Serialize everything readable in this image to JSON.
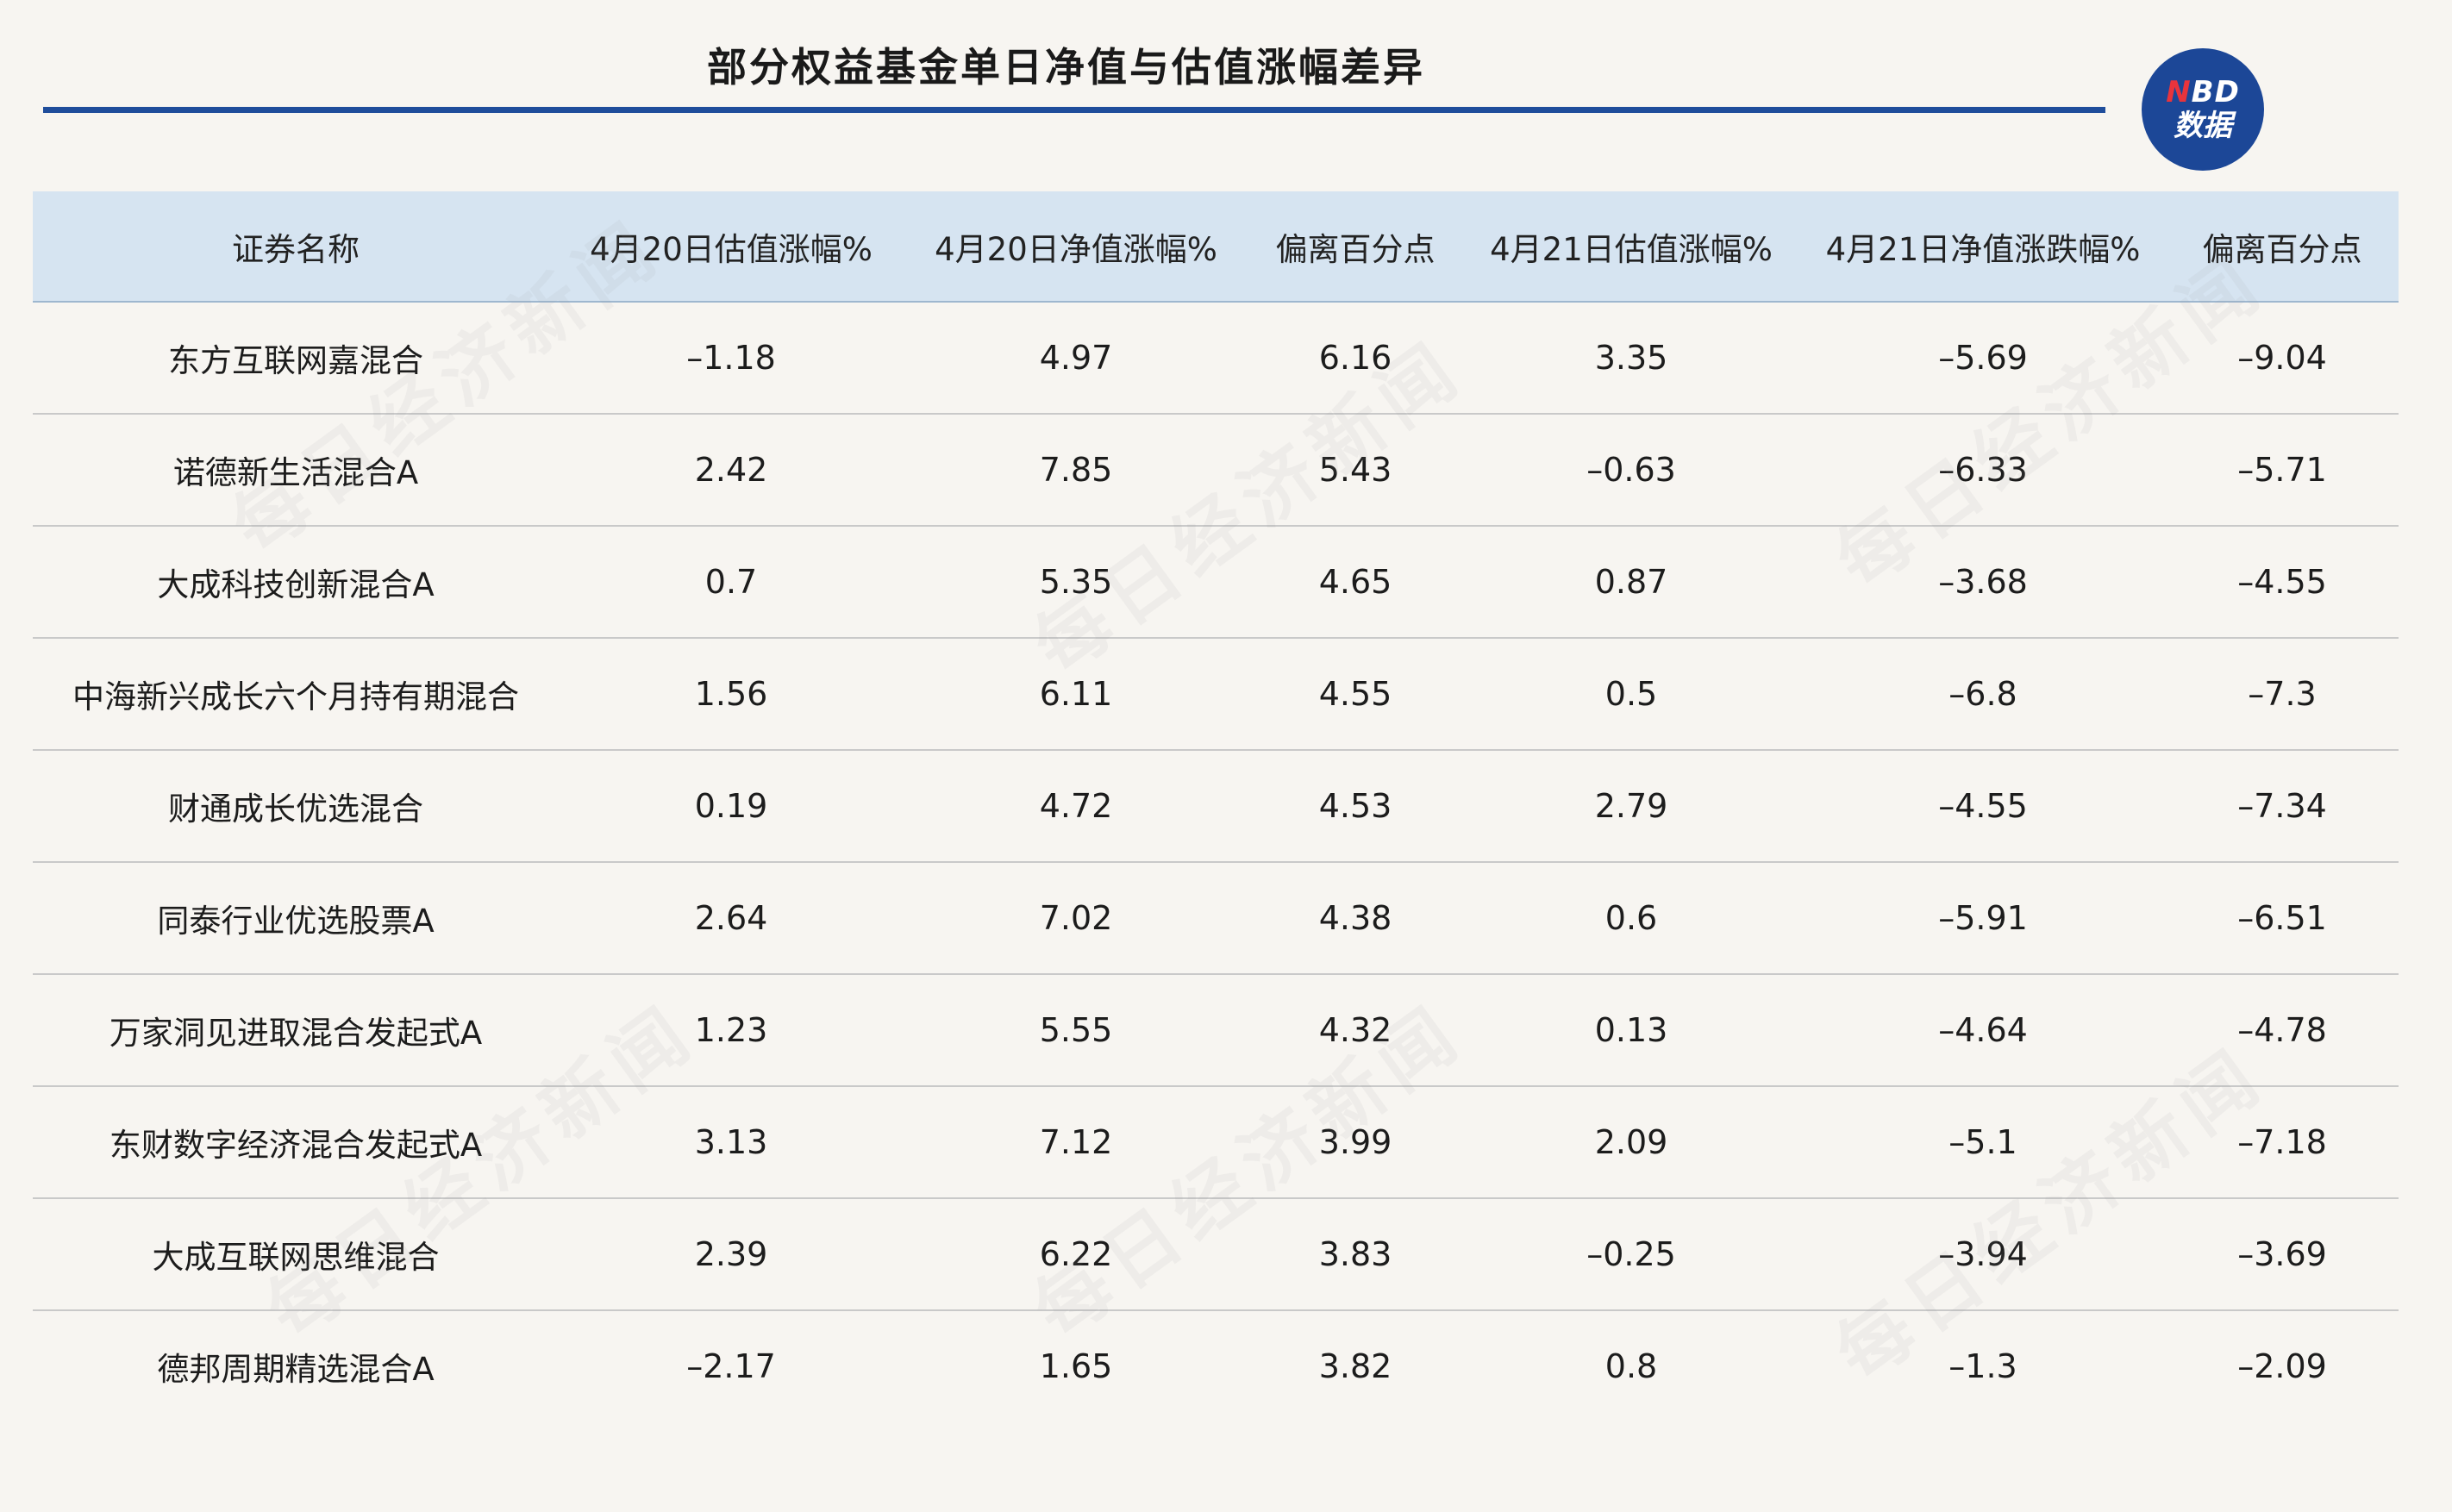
{
  "title": "部分权益基金单日净值与估值涨幅差异",
  "logo": {
    "line1_n": "N",
    "line1_rest": "BD",
    "line2": "数据"
  },
  "watermark": "每日经济新闻",
  "chart_data": {
    "type": "table",
    "columns": [
      "证券名称",
      "4月20日估值涨幅%",
      "4月20日净值涨幅%",
      "偏离百分点",
      "4月21日估值涨幅%",
      "4月21日净值涨跌幅%",
      "偏离百分点"
    ],
    "rows": [
      [
        "东方互联网嘉混合",
        "–1.18",
        "4.97",
        "6.16",
        "3.35",
        "–5.69",
        "–9.04"
      ],
      [
        "诺德新生活混合A",
        "2.42",
        "7.85",
        "5.43",
        "–0.63",
        "–6.33",
        "–5.71"
      ],
      [
        "大成科技创新混合A",
        "0.7",
        "5.35",
        "4.65",
        "0.87",
        "–3.68",
        "–4.55"
      ],
      [
        "中海新兴成长六个月持有期混合",
        "1.56",
        "6.11",
        "4.55",
        "0.5",
        "–6.8",
        "–7.3"
      ],
      [
        "财通成长优选混合",
        "0.19",
        "4.72",
        "4.53",
        "2.79",
        "–4.55",
        "–7.34"
      ],
      [
        "同泰行业优选股票A",
        "2.64",
        "7.02",
        "4.38",
        "0.6",
        "–5.91",
        "–6.51"
      ],
      [
        "万家洞见进取混合发起式A",
        "1.23",
        "5.55",
        "4.32",
        "0.13",
        "–4.64",
        "–4.78"
      ],
      [
        "东财数字经济混合发起式A",
        "3.13",
        "7.12",
        "3.99",
        "2.09",
        "–5.1",
        "–7.18"
      ],
      [
        "大成互联网思维混合",
        "2.39",
        "6.22",
        "3.83",
        "–0.25",
        "–3.94",
        "–3.69"
      ],
      [
        "德邦周期精选混合A",
        "–2.17",
        "1.65",
        "3.82",
        "0.8",
        "–1.3",
        "–2.09"
      ]
    ]
  },
  "colors": {
    "accent": "#1f4d9b",
    "header_bg": "#d6e4f1",
    "page_bg": "#f7f5f1",
    "logo_bg": "#1c4797",
    "logo_n": "#e8343c"
  }
}
